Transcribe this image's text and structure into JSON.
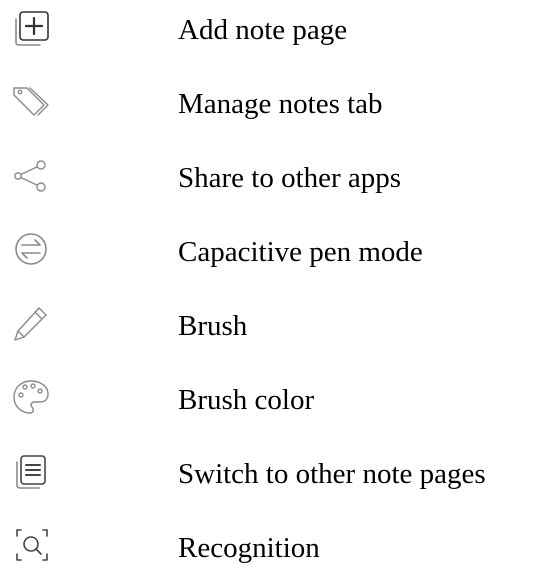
{
  "icon_color": "#8a8a8a",
  "items": [
    {
      "icon": "add-page-icon",
      "label": "Add note page"
    },
    {
      "icon": "tag-icon",
      "label": "Manage notes tab"
    },
    {
      "icon": "share-icon",
      "label": "Share to other apps"
    },
    {
      "icon": "swap-icon",
      "label": "Capacitive pen mode"
    },
    {
      "icon": "pencil-icon",
      "label": "Brush"
    },
    {
      "icon": "palette-icon",
      "label": "Brush color"
    },
    {
      "icon": "pages-icon",
      "label": "Switch to other note pages"
    },
    {
      "icon": "scan-icon",
      "label": "Recognition"
    }
  ]
}
